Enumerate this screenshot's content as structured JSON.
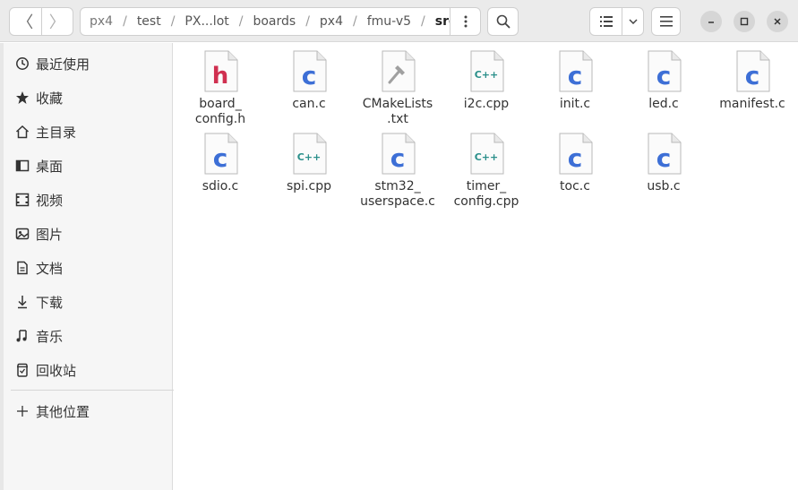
{
  "navigation": {
    "back_label": "〈",
    "forward_label": "〉"
  },
  "pathbar": {
    "crumbs": [
      "px4",
      "test",
      "PX...lot",
      "boards",
      "px4",
      "fmu-v5",
      "src"
    ],
    "separator": "/"
  },
  "sidebar": {
    "items": [
      {
        "label": "最近使用",
        "icon": "clock-icon"
      },
      {
        "label": "收藏",
        "icon": "star-icon"
      },
      {
        "label": "主目录",
        "icon": "home-icon"
      },
      {
        "label": "桌面",
        "icon": "desktop-icon"
      },
      {
        "label": "视频",
        "icon": "video-icon"
      },
      {
        "label": "图片",
        "icon": "image-icon"
      },
      {
        "label": "文档",
        "icon": "document-icon"
      },
      {
        "label": "下载",
        "icon": "download-icon"
      },
      {
        "label": "音乐",
        "icon": "music-icon"
      },
      {
        "label": "回收站",
        "icon": "trash-icon"
      }
    ],
    "other_locations": {
      "label": "其他位置",
      "icon": "plus-icon"
    }
  },
  "files": [
    {
      "name": "board_\nconfig.h",
      "type": "h"
    },
    {
      "name": "can.c",
      "type": "c"
    },
    {
      "name": "CMakeLists\n.txt",
      "type": "cmake"
    },
    {
      "name": "i2c.cpp",
      "type": "cpp"
    },
    {
      "name": "init.c",
      "type": "c"
    },
    {
      "name": "led.c",
      "type": "c"
    },
    {
      "name": "manifest.c",
      "type": "c"
    },
    {
      "name": "sdio.c",
      "type": "c"
    },
    {
      "name": "spi.cpp",
      "type": "cpp"
    },
    {
      "name": "stm32_\nuserspace.c",
      "type": "c"
    },
    {
      "name": "timer_\nconfig.cpp",
      "type": "cpp"
    },
    {
      "name": "toc.c",
      "type": "c"
    },
    {
      "name": "usb.c",
      "type": "c"
    }
  ],
  "colors": {
    "c_icon": "#3d6fd6",
    "h_icon": "#d03050",
    "cpp_icon": "#2a8f8a",
    "cmake_icon": "#9a9a9a"
  }
}
